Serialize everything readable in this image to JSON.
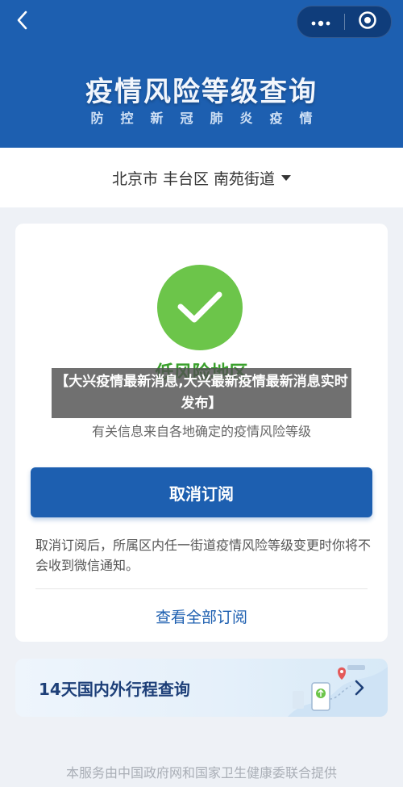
{
  "header": {
    "title": "疫情风险等级查询",
    "subtitle": "防控新冠肺炎疫情",
    "back_icon": "chevron-left-icon",
    "more_icon": "more-dots-icon",
    "close_icon": "target-circle-icon",
    "background": "#1d5fb0"
  },
  "location": {
    "label": "北京市 丰台区 南苑街道",
    "dropdown_icon": "caret-down-icon"
  },
  "status_card": {
    "risk_label": "低风险地区",
    "risk_color": "#3aa02c",
    "check_color": "#6cc54a",
    "info_text": "有关信息来自各地确定的疫情风险等级",
    "unsubscribe_label": "取消订阅",
    "note_text": "取消订阅后，所属区内任一街道疫情风险等级变更时你将不会收到微信通知。",
    "view_all_label": "查看全部订阅"
  },
  "trip_card": {
    "title": "14天国内外行程查询",
    "chevron_icon": "chevron-right-icon"
  },
  "footer": {
    "text": "本服务由中国政府网和国家卫生健康委联合提供"
  },
  "overlay": {
    "caption": "【大兴疫情最新消息,大兴最新疫情最新消息实时发布】"
  }
}
